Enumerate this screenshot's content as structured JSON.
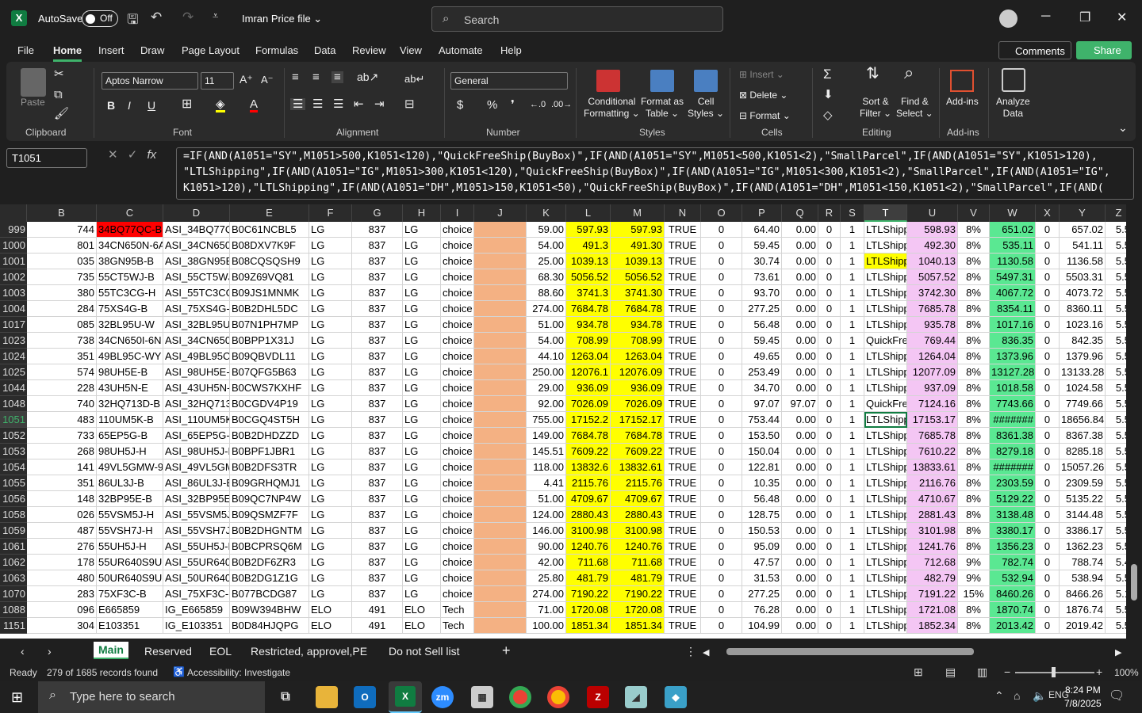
{
  "titlebar": {
    "autosave": "AutoSave",
    "toggle": "Off",
    "filename": "Imran Price file ⌄",
    "search_placeholder": "Search"
  },
  "menu": [
    "File",
    "Home",
    "Insert",
    "Draw",
    "Page Layout",
    "Formulas",
    "Data",
    "Review",
    "View",
    "Automate",
    "Help"
  ],
  "buttons": {
    "comments": "Comments",
    "share": "Share"
  },
  "ribbon": {
    "paste": "Paste",
    "font_name": "Aptos Narrow",
    "font_size": "11",
    "number_format": "General",
    "conditional": "Conditional\nFormatting ⌄",
    "format_table": "Format as\nTable ⌄",
    "cell_styles": "Cell\nStyles ⌄",
    "insert": "Insert",
    "delete": "Delete",
    "format": "Format ⌄",
    "sort": "Sort &\nFilter ⌄",
    "find": "Find &\nSelect ⌄",
    "addins": "Add-ins",
    "analyze": "Analyze\nData",
    "groups": [
      "Clipboard",
      "Font",
      "Alignment",
      "Number",
      "Styles",
      "Cells",
      "Editing",
      "Add-ins"
    ]
  },
  "namebox": "T1051",
  "formula": "=IF(AND(A1051=\"SY\",M1051>500,K1051<120),\"QuickFreeShip(BuyBox)\",IF(AND(A1051=\"SY\",M1051<500,K1051<2),\"SmallParcel\",IF(AND(A1051=\"SY\",K1051>120),\n\"LTLShipping\",IF(AND(A1051=\"IG\",M1051>300,K1051<120),\"QuickFreeShip(BuyBox)\",IF(AND(A1051=\"IG\",M1051<300,K1051<2),\"SmallParcel\",IF(AND(A1051=\"IG\",\nK1051>120),\"LTLShipping\",IF(AND(A1051=\"DH\",M1051>150,K1051<50),\"QuickFreeShip(BuyBox)\",IF(AND(A1051=\"DH\",M1051<150,K1051<2),\"SmallParcel\",IF(AND(",
  "columns": [
    "B",
    "C",
    "D",
    "E",
    "F",
    "G",
    "H",
    "I",
    "J",
    "K",
    "L",
    "M",
    "N",
    "O",
    "P",
    "Q",
    "R",
    "S",
    "T",
    "U",
    "V",
    "W",
    "X",
    "Y",
    "Z"
  ],
  "rows": [
    {
      "n": "999",
      "c": [
        "744",
        "34BQ77QC-B",
        "ASI_34BQ77Q",
        "B0C61NCBL5",
        "LG",
        "837",
        "LG",
        "choice",
        "",
        "59.00",
        "597.93",
        "597.93",
        "TRUE",
        "0",
        "64.40",
        "0.00",
        "0",
        "1",
        "LTLShipp",
        "598.93",
        "8%",
        "651.02",
        "0",
        "657.02",
        "5.5"
      ]
    },
    {
      "n": "1000",
      "c": [
        "801",
        "34CN650N-6A",
        "ASI_34CN650I",
        "B08DXV7K9F",
        "LG",
        "837",
        "LG",
        "choice",
        "",
        "54.00",
        "491.3",
        "491.30",
        "TRUE",
        "0",
        "59.45",
        "0.00",
        "0",
        "1",
        "LTLShipp",
        "492.30",
        "8%",
        "535.11",
        "0",
        "541.11",
        "5.5"
      ]
    },
    {
      "n": "1001",
      "c": [
        "035",
        "38GN95B-B",
        "ASI_38GN95B",
        "B08CQSQSH9",
        "LG",
        "837",
        "LG",
        "choice",
        "",
        "25.00",
        "1039.13",
        "1039.13",
        "TRUE",
        "0",
        "30.74",
        "0.00",
        "0",
        "1",
        "LTLShipp",
        "1040.13",
        "8%",
        "1130.58",
        "0",
        "1136.58",
        "5.5"
      ]
    },
    {
      "n": "1002",
      "c": [
        "735",
        "55CT5WJ-B",
        "ASI_55CT5WJ-",
        "B09Z69VQ81",
        "LG",
        "837",
        "LG",
        "choice",
        "",
        "68.30",
        "5056.52",
        "5056.52",
        "TRUE",
        "0",
        "73.61",
        "0.00",
        "0",
        "1",
        "LTLShipp",
        "5057.52",
        "8%",
        "5497.31",
        "0",
        "5503.31",
        "5.5"
      ]
    },
    {
      "n": "1003",
      "c": [
        "380",
        "55TC3CG-H",
        "ASI_55TC3CG-",
        "B09JS1MNMK",
        "LG",
        "837",
        "LG",
        "choice",
        "",
        "88.60",
        "3741.3",
        "3741.30",
        "TRUE",
        "0",
        "93.70",
        "0.00",
        "0",
        "1",
        "LTLShipp",
        "3742.30",
        "8%",
        "4067.72",
        "0",
        "4073.72",
        "5.5"
      ]
    },
    {
      "n": "1004",
      "c": [
        "284",
        "75XS4G-B",
        "ASI_75XS4G-B",
        "B0B2DHL5DC",
        "LG",
        "837",
        "LG",
        "choice",
        "",
        "274.00",
        "7684.78",
        "7684.78",
        "TRUE",
        "0",
        "277.25",
        "0.00",
        "0",
        "1",
        "LTLShipp",
        "7685.78",
        "8%",
        "8354.11",
        "0",
        "8360.11",
        "5.5"
      ]
    },
    {
      "n": "1017",
      "c": [
        "085",
        "32BL95U-W",
        "ASI_32BL95U-",
        "B07N1PH7MP",
        "LG",
        "837",
        "LG",
        "choice",
        "",
        "51.00",
        "934.78",
        "934.78",
        "TRUE",
        "0",
        "56.48",
        "0.00",
        "0",
        "1",
        "LTLShipp",
        "935.78",
        "8%",
        "1017.16",
        "0",
        "1023.16",
        "5.5"
      ]
    },
    {
      "n": "1023",
      "c": [
        "738",
        "34CN650I-6N",
        "ASI_34CN650I",
        "B0BPP1X31J",
        "LG",
        "837",
        "LG",
        "choice",
        "",
        "54.00",
        "708.99",
        "708.99",
        "TRUE",
        "0",
        "59.45",
        "0.00",
        "0",
        "1",
        "QuickFre",
        "769.44",
        "8%",
        "836.35",
        "0",
        "842.35",
        "5.5"
      ]
    },
    {
      "n": "1024",
      "c": [
        "351",
        "49BL95C-WY",
        "ASI_49BL95C-",
        "B09QBVDL11",
        "LG",
        "837",
        "LG",
        "choice",
        "",
        "44.10",
        "1263.04",
        "1263.04",
        "TRUE",
        "0",
        "49.65",
        "0.00",
        "0",
        "1",
        "LTLShipp",
        "1264.04",
        "8%",
        "1373.96",
        "0",
        "1379.96",
        "5.5"
      ]
    },
    {
      "n": "1025",
      "c": [
        "574",
        "98UH5E-B",
        "ASI_98UH5E-E",
        "B07QFG5B63",
        "LG",
        "837",
        "LG",
        "choice",
        "",
        "250.00",
        "12076.1",
        "12076.09",
        "TRUE",
        "0",
        "253.49",
        "0.00",
        "0",
        "1",
        "LTLShipp",
        "12077.09",
        "8%",
        "13127.28",
        "0",
        "13133.28",
        "5.5"
      ]
    },
    {
      "n": "1044",
      "c": [
        "228",
        "43UH5N-E",
        "ASI_43UH5N-I",
        "B0CWS7KXHF",
        "LG",
        "837",
        "LG",
        "choice",
        "",
        "29.00",
        "936.09",
        "936.09",
        "TRUE",
        "0",
        "34.70",
        "0.00",
        "0",
        "1",
        "LTLShipp",
        "937.09",
        "8%",
        "1018.58",
        "0",
        "1024.58",
        "5.5"
      ]
    },
    {
      "n": "1048",
      "c": [
        "740",
        "32HQ713D-B",
        "ASI_32HQ713I",
        "B0CGDV4P19",
        "LG",
        "837",
        "LG",
        "choice",
        "",
        "92.00",
        "7026.09",
        "7026.09",
        "TRUE",
        "0",
        "97.07",
        "97.07",
        "0",
        "1",
        "QuickFre",
        "7124.16",
        "8%",
        "7743.66",
        "0",
        "7749.66",
        "5.5"
      ]
    },
    {
      "n": "1051",
      "c": [
        "483",
        "110UM5K-B",
        "ASI_110UM5K",
        "B0CGQ4ST5H",
        "LG",
        "837",
        "LG",
        "choice",
        "",
        "755.00",
        "17152.2",
        "17152.17",
        "TRUE",
        "0",
        "753.44",
        "0.00",
        "0",
        "1",
        "LTLShipp",
        "17153.17",
        "8%",
        "#######",
        "0",
        "18656.84",
        "5.5"
      ]
    },
    {
      "n": "1052",
      "c": [
        "733",
        "65EP5G-B",
        "ASI_65EP5G-B",
        "B0B2DHDZZD",
        "LG",
        "837",
        "LG",
        "choice",
        "",
        "149.00",
        "7684.78",
        "7684.78",
        "TRUE",
        "0",
        "153.50",
        "0.00",
        "0",
        "1",
        "LTLShipp",
        "7685.78",
        "8%",
        "8361.38",
        "0",
        "8367.38",
        "5.5"
      ]
    },
    {
      "n": "1053",
      "c": [
        "268",
        "98UH5J-H",
        "ASI_98UH5J-H",
        "B0BPF1JBR1",
        "LG",
        "837",
        "LG",
        "choice",
        "",
        "145.51",
        "7609.22",
        "7609.22",
        "TRUE",
        "0",
        "150.04",
        "0.00",
        "0",
        "1",
        "LTLShipp",
        "7610.22",
        "8%",
        "8279.18",
        "0",
        "8285.18",
        "5.5"
      ]
    },
    {
      "n": "1054",
      "c": [
        "141",
        "49VL5GMW-9",
        "ASI_49VL5GM",
        "B0B2DFS3TR",
        "LG",
        "837",
        "LG",
        "choice",
        "",
        "118.00",
        "13832.6",
        "13832.61",
        "TRUE",
        "0",
        "122.81",
        "0.00",
        "0",
        "1",
        "LTLShipp",
        "13833.61",
        "8%",
        "#######",
        "0",
        "15057.26",
        "5.5"
      ]
    },
    {
      "n": "1055",
      "c": [
        "351",
        "86UL3J-B",
        "ASI_86UL3J-B",
        "B09GRHQMJ1",
        "LG",
        "837",
        "LG",
        "choice",
        "",
        "4.41",
        "2115.76",
        "2115.76",
        "TRUE",
        "0",
        "10.35",
        "0.00",
        "0",
        "1",
        "LTLShipp",
        "2116.76",
        "8%",
        "2303.59",
        "0",
        "2309.59",
        "5.5"
      ]
    },
    {
      "n": "1056",
      "c": [
        "148",
        "32BP95E-B",
        "ASI_32BP95E-",
        "B09QC7NP4W",
        "LG",
        "837",
        "LG",
        "choice",
        "",
        "51.00",
        "4709.67",
        "4709.67",
        "TRUE",
        "0",
        "56.48",
        "0.00",
        "0",
        "1",
        "LTLShipp",
        "4710.67",
        "8%",
        "5129.22",
        "0",
        "5135.22",
        "5.5"
      ]
    },
    {
      "n": "1058",
      "c": [
        "026",
        "55VSM5J-H",
        "ASI_55VSM5J-",
        "B09QSMZF7F",
        "LG",
        "837",
        "LG",
        "choice",
        "",
        "124.00",
        "2880.43",
        "2880.43",
        "TRUE",
        "0",
        "128.75",
        "0.00",
        "0",
        "1",
        "LTLShipp",
        "2881.43",
        "8%",
        "3138.48",
        "0",
        "3144.48",
        "5.5"
      ]
    },
    {
      "n": "1059",
      "c": [
        "487",
        "55VSH7J-H",
        "ASI_55VSH7J-",
        "B0B2DHGNTM",
        "LG",
        "837",
        "LG",
        "choice",
        "",
        "146.00",
        "3100.98",
        "3100.98",
        "TRUE",
        "0",
        "150.53",
        "0.00",
        "0",
        "1",
        "LTLShipp",
        "3101.98",
        "8%",
        "3380.17",
        "0",
        "3386.17",
        "5.5"
      ]
    },
    {
      "n": "1061",
      "c": [
        "276",
        "55UH5J-H",
        "ASI_55UH5J-H",
        "B0BCPRSQ6M",
        "LG",
        "837",
        "LG",
        "choice",
        "",
        "90.00",
        "1240.76",
        "1240.76",
        "TRUE",
        "0",
        "95.09",
        "0.00",
        "0",
        "1",
        "LTLShipp",
        "1241.76",
        "8%",
        "1356.23",
        "0",
        "1362.23",
        "5.5"
      ]
    },
    {
      "n": "1062",
      "c": [
        "178",
        "55UR640S9UI",
        "ASI_55UR640S",
        "B0B2DF6ZR3",
        "LG",
        "837",
        "LG",
        "choice",
        "",
        "42.00",
        "711.68",
        "711.68",
        "TRUE",
        "0",
        "47.57",
        "0.00",
        "0",
        "1",
        "LTLShipp",
        "712.68",
        "9%",
        "782.74",
        "0",
        "788.74",
        "5.4"
      ]
    },
    {
      "n": "1063",
      "c": [
        "480",
        "50UR640S9UI",
        "ASI_50UR640S",
        "B0B2DG1Z1G",
        "LG",
        "837",
        "LG",
        "choice",
        "",
        "25.80",
        "481.79",
        "481.79",
        "TRUE",
        "0",
        "31.53",
        "0.00",
        "0",
        "1",
        "LTLShipp",
        "482.79",
        "9%",
        "532.94",
        "0",
        "538.94",
        "5.5"
      ]
    },
    {
      "n": "1070",
      "c": [
        "283",
        "75XF3C-B",
        "ASI_75XF3C-B",
        "B077BCDG87",
        "LG",
        "837",
        "LG",
        "choice",
        "",
        "274.00",
        "7190.22",
        "7190.22",
        "TRUE",
        "0",
        "277.25",
        "0.00",
        "0",
        "1",
        "LTLShipp",
        "7191.22",
        "15%",
        "8460.26",
        "0",
        "8466.26",
        "5.1"
      ]
    },
    {
      "n": "1088",
      "c": [
        "096",
        "E665859",
        "IG_E665859",
        "B09W394BHW",
        "ELO",
        "491",
        "ELO",
        "Tech",
        "",
        "71.00",
        "1720.08",
        "1720.08",
        "TRUE",
        "0",
        "76.28",
        "0.00",
        "0",
        "1",
        "LTLShipp",
        "1721.08",
        "8%",
        "1870.74",
        "0",
        "1876.74",
        "5.5"
      ]
    },
    {
      "n": "1151",
      "c": [
        "304",
        "E103351",
        "IG_E103351",
        "B0D84HJQPG",
        "ELO",
        "491",
        "ELO",
        "Tech",
        "",
        "100.00",
        "1851.34",
        "1851.34",
        "TRUE",
        "0",
        "104.99",
        "0.00",
        "0",
        "1",
        "LTLShipp",
        "1852.34",
        "8%",
        "2013.42",
        "0",
        "2019.42",
        "5.5"
      ]
    }
  ],
  "sheets": [
    "Main",
    "Reserved",
    "EOL",
    "Restricted, approvel,PE",
    "Do not Sell list"
  ],
  "status": {
    "ready": "Ready",
    "records": "279 of 1685 records found",
    "accessibility": "Accessibility: Investigate",
    "zoom": "100%"
  },
  "taskbar": {
    "search": "Type here to search",
    "time": "8:24 PM",
    "date": "7/8/2025"
  },
  "colors": {
    "yellow": "#ffff00",
    "pink": "#f4c6f4",
    "green": "#5ae892",
    "salmon": "#f4b183",
    "red": "#ff0000",
    "accent": "#3fb36b"
  }
}
